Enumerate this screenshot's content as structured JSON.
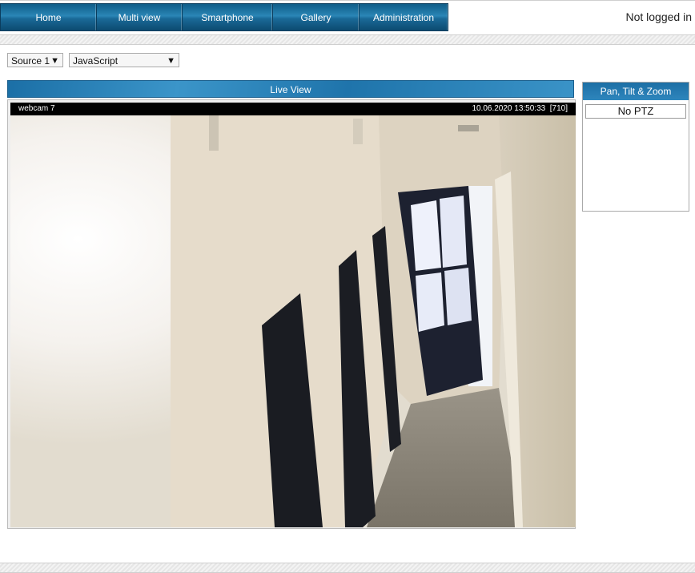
{
  "nav": {
    "items": [
      {
        "label": "Home"
      },
      {
        "label": "Multi view"
      },
      {
        "label": "Smartphone"
      },
      {
        "label": "Gallery"
      },
      {
        "label": "Administration"
      }
    ]
  },
  "login_status": "Not logged in",
  "controls": {
    "source_select": "Source 1",
    "viewer_select": "JavaScript"
  },
  "live_view": {
    "title": "Live View",
    "camera_name": "webcam 7",
    "timestamp": "10.06.2020 13:50:33  [710]"
  },
  "ptz": {
    "title": "Pan, Tilt & Zoom",
    "status": "No PTZ"
  }
}
